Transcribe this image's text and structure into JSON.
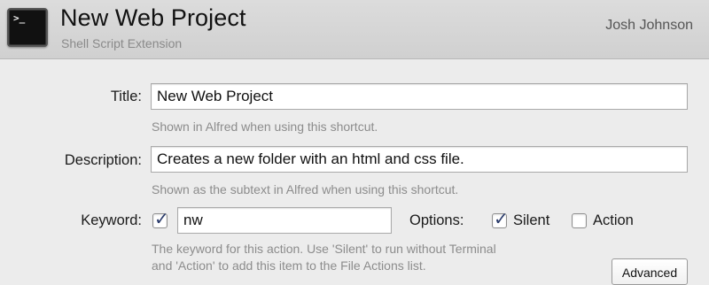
{
  "header": {
    "title": "New Web Project",
    "subtitle": "Shell Script Extension",
    "author": "Josh Johnson",
    "icon": "terminal-icon",
    "icon_glyph": ">_"
  },
  "form": {
    "title_label": "Title:",
    "title_value": "New Web Project",
    "title_hint": "Shown in Alfred when using this shortcut.",
    "description_label": "Description:",
    "description_value": "Creates a new folder with an html and css file.",
    "description_hint": "Shown as the subtext in Alfred when using this shortcut.",
    "keyword_label": "Keyword:",
    "keyword_enabled": true,
    "keyword_value": "nw",
    "options_label": "Options:",
    "silent_label": "Silent",
    "silent_checked": true,
    "action_label": "Action",
    "action_checked": false,
    "keyword_hint_line1": "The keyword for this action. Use 'Silent' to run without Terminal",
    "keyword_hint_line2": "and 'Action' to add this item to the File Actions list.",
    "advanced_button": "Advanced"
  }
}
